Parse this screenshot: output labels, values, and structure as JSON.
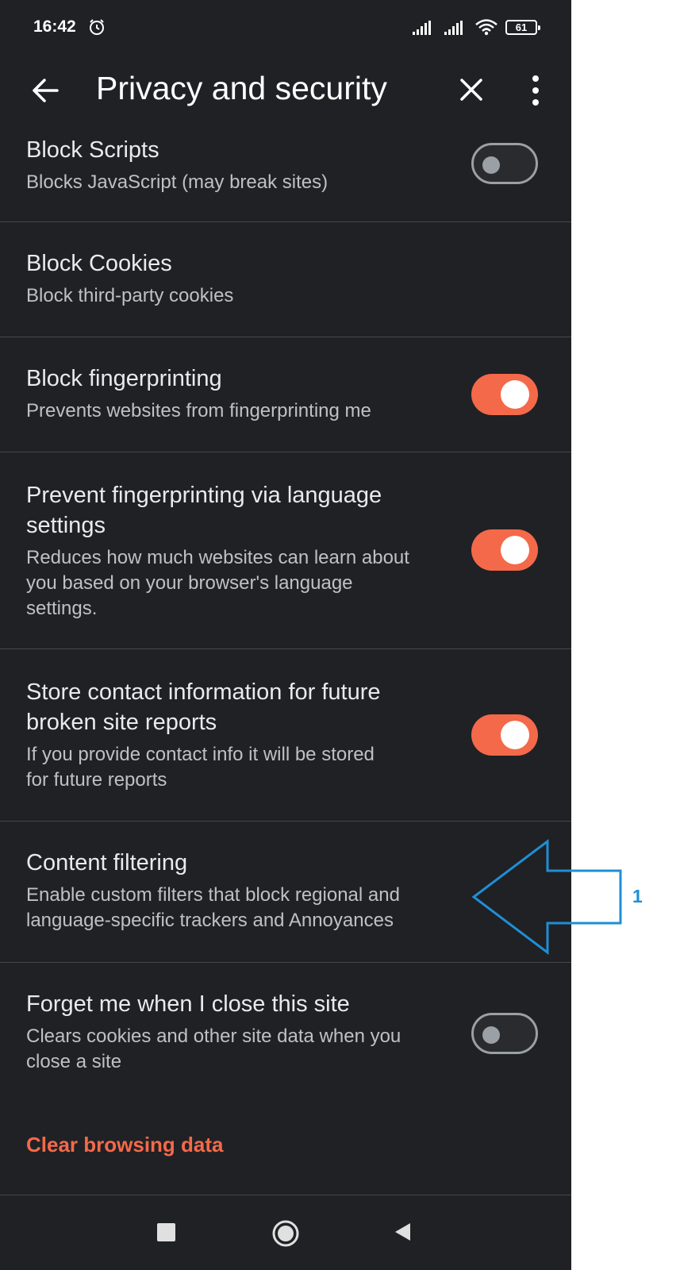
{
  "status_bar": {
    "time": "16:42",
    "battery": "61",
    "icons": [
      "alarm-icon",
      "signal-icon",
      "signal-icon",
      "wifi-icon",
      "battery-icon"
    ]
  },
  "toolbar": {
    "title": "Privacy and security",
    "back_icon": "arrow-left-icon",
    "close_icon": "close-icon",
    "more_icon": "more-vert-icon"
  },
  "settings": [
    {
      "title": "Block Scripts",
      "subtitle": "Blocks JavaScript (may break sites)",
      "toggle": "off"
    },
    {
      "title": "Block Cookies",
      "subtitle": "Block third-party cookies"
    },
    {
      "title": "Block fingerprinting",
      "subtitle": "Prevents websites from fingerprinting me",
      "toggle": "on"
    },
    {
      "title": "Prevent fingerprinting via language settings",
      "subtitle": "Reduces how much websites can learn about you based on your browser's language settings.",
      "toggle": "on"
    },
    {
      "title": "Store contact information for future broken site reports",
      "subtitle": "If you provide contact info it will be stored for future reports",
      "toggle": "on"
    },
    {
      "title": "Content filtering",
      "subtitle": "Enable custom filters that block regional and language-specific trackers and Annoyances"
    },
    {
      "title": "Forget me when I close this site",
      "subtitle": "Clears cookies and other site data when you close a site",
      "toggle": "off"
    }
  ],
  "clear_browsing_data": "Clear browsing data",
  "annotation": {
    "label": "1",
    "color": "#1e8fd6"
  },
  "colors": {
    "background": "#202124",
    "accent": "#f4694a",
    "divider": "#46474a"
  },
  "nav_bar": {
    "icons": [
      "recents-square-icon",
      "home-circle-icon",
      "back-triangle-icon"
    ]
  }
}
